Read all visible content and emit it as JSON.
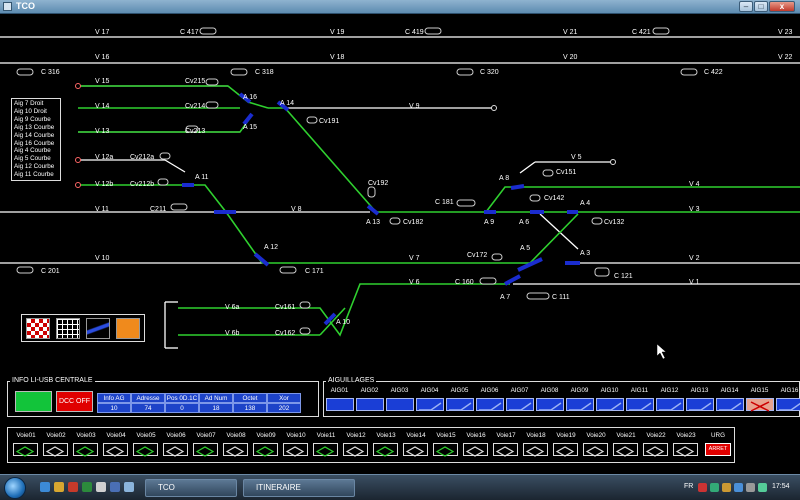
{
  "window": {
    "title": "TCO",
    "minimize": "–",
    "maximize": "□",
    "close": "x"
  },
  "tracks": {
    "voies": [
      "V 17",
      "V 19",
      "V 21",
      "V 23",
      "V 16",
      "V 18",
      "V 20",
      "V 22",
      "V 15",
      "V 14",
      "V 13",
      "V 9",
      "V 12a",
      "V 12b",
      "V 11",
      "V 8",
      "V 5",
      "V 4",
      "V 3",
      "V 10",
      "V 7",
      "V 2",
      "V 6",
      "V 1",
      "V 6a",
      "V 6b"
    ],
    "aiguilles": [
      "A 16",
      "A 15",
      "A 14",
      "A 11",
      "A 12",
      "A 13",
      "A 9",
      "A 8",
      "A 6",
      "A 4",
      "A 5",
      "A 3",
      "A 7",
      "A 10"
    ],
    "signals": [
      "C 417",
      "C 419",
      "C 421",
      "C 316",
      "C 318",
      "C 320",
      "C 422",
      "Cv215",
      "Cv214",
      "Cv213",
      "Cv191",
      "Cv212a",
      "Cv212b",
      "C211",
      "Cv192",
      "C 181",
      "Cv182",
      "Cv151",
      "Cv142",
      "Cv132",
      "C 201",
      "C 171",
      "Cv172",
      "C 160",
      "C 121",
      "C 111",
      "Cv161",
      "Cv162"
    ]
  },
  "legend": [
    "Aig 7 Droit",
    "Aig 10 Droit",
    "Aig 9 Courbe",
    "Aig 13 Courbe",
    "Aig 14 Courbe",
    "Aig 16 Courbe",
    "Aig 4 Courbe",
    "Aig 5 Courbe",
    "Aig 12 Courbe",
    "Aig 11 Courbe"
  ],
  "tools": [
    "checker-icon",
    "grid-icon",
    "track-icon",
    "orange-tool-icon"
  ],
  "info_panel": {
    "title": "INFO LI-USB CENTRALE",
    "status_on": "",
    "status_off": "DCC OFF",
    "headers": [
      "Info AG",
      "Adresse",
      "Pos 0D.1C",
      "Ad Num",
      "Octet",
      "Xor"
    ],
    "values": [
      "10",
      "74",
      "0",
      "18",
      "138",
      "202"
    ]
  },
  "aiguillages_panel": {
    "title": "AIGUILLAGES",
    "items": [
      "AIG01",
      "AIG02",
      "AIG03",
      "AIG04",
      "AIG05",
      "AIG06",
      "AIG07",
      "AIG08",
      "AIG09",
      "AIG10",
      "AIG11",
      "AIG12",
      "AIG13",
      "AIG14",
      "AIG15",
      "AIG16"
    ]
  },
  "voies_panel": {
    "items": [
      "Voie01",
      "Voie02",
      "Voie03",
      "Voie04",
      "Voie05",
      "Voie06",
      "Voie07",
      "Voie08",
      "Voie09",
      "Voie10",
      "Voie11",
      "Voie12",
      "Voie13",
      "Voie14",
      "Voie15",
      "Voie16",
      "Voie17",
      "Voie18",
      "Voie19",
      "Voie20",
      "Voie21",
      "Voie22",
      "Voie23"
    ],
    "urg_label": "URG",
    "urg_button": "ARRET"
  },
  "taskbar": {
    "tasks": [
      "TCO",
      "ITINERAIRE"
    ],
    "lang": "FR",
    "clock": "17:54"
  },
  "colors": {
    "active_track": "#2fd02f",
    "idle_track": "#ffffff",
    "aiguille_mark": "#1a2ccf",
    "urg": "#e00000"
  }
}
